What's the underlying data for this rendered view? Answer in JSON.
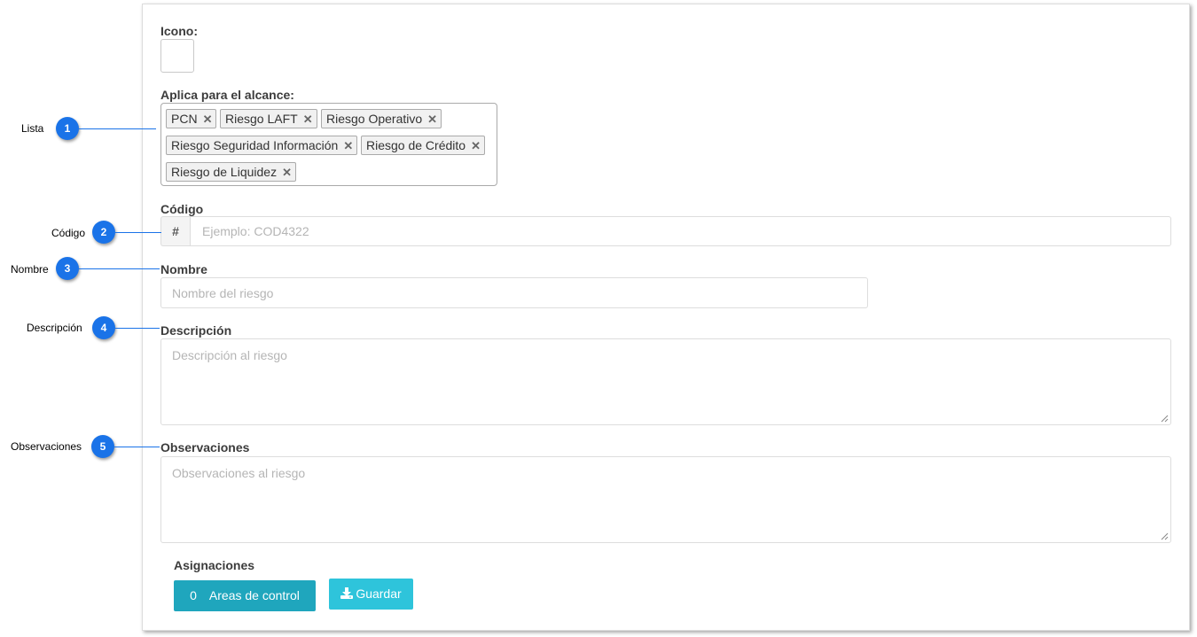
{
  "form": {
    "icono_label": "Icono:",
    "alcance_label": "Aplica para el alcance:",
    "alcance_tags": [
      "PCN",
      "Riesgo LAFT",
      "Riesgo Operativo",
      "Riesgo Seguridad Información",
      "Riesgo de Crédito",
      "Riesgo de Liquidez"
    ],
    "codigo_label": "Código",
    "codigo_addon": "#",
    "codigo_placeholder": "Ejemplo: COD4322",
    "nombre_label": "Nombre",
    "nombre_placeholder": "Nombre del riesgo",
    "descripcion_label": "Descripción",
    "descripcion_placeholder": "Descripción al riesgo",
    "observaciones_label": "Observaciones",
    "observaciones_placeholder": "Observaciones al riesgo",
    "asignaciones_label": "Asignaciones",
    "areas_count": "0",
    "areas_label": "Areas de control",
    "guardar_label": "Guardar",
    "guardar_icon": "download-icon"
  },
  "callouts": [
    {
      "number": "1",
      "label": "Lista"
    },
    {
      "number": "2",
      "label": "Código"
    },
    {
      "number": "3",
      "label": "Nombre"
    },
    {
      "number": "4",
      "label": "Descripción"
    },
    {
      "number": "5",
      "label": "Observaciones"
    }
  ],
  "colors": {
    "callout_blue": "#1a73e8",
    "areas_button": "#1fa6bd",
    "guardar_button": "#2ec4db"
  }
}
